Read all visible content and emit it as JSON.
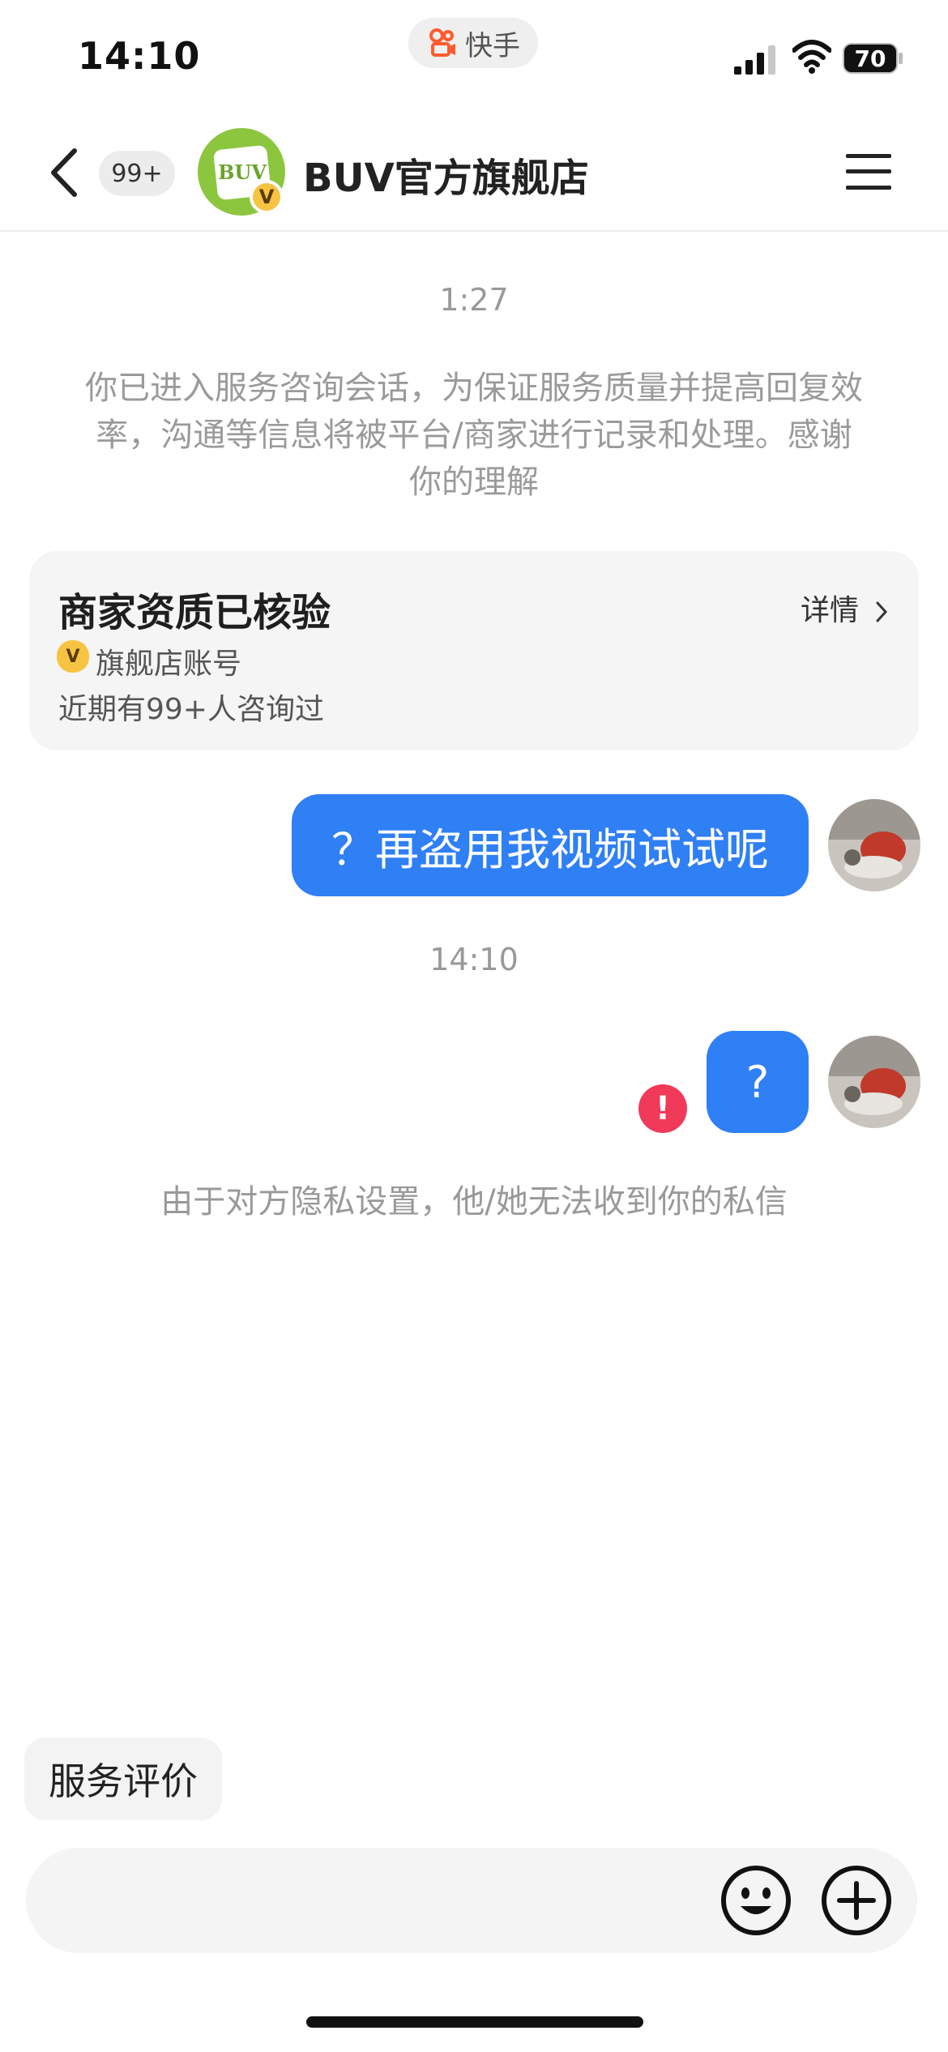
{
  "status_bar": {
    "time": "14:10",
    "app_pill": "快手",
    "battery": "70"
  },
  "header": {
    "unread_badge": "99+",
    "avatar_text": "BUV",
    "shop_name": "BUV官方旗舰店"
  },
  "chat": {
    "time1": "1:27",
    "notice": "你已进入服务咨询会话，为保证服务质量并提高回复效率，沟通等信息将被平台/商家进行记录和处理。感谢你的理解",
    "card": {
      "title": "商家资质已核验",
      "detail": "详情",
      "v_mark": "V",
      "account_type": "旗舰店账号",
      "consult_count": "近期有99+人咨询过"
    },
    "message1": "？再盗用我视频试试呢",
    "time2": "14:10",
    "message2": "?",
    "error_mark": "!",
    "privacy_note": "由于对方隐私设置，他/她无法收到你的私信"
  },
  "bottom": {
    "rate_button": "服务评价",
    "input_placeholder": ""
  },
  "colors": {
    "bubble": "#2f7ff5",
    "error": "#f13a59",
    "vip": "#f6c343",
    "avatar_green": "#8cc63f"
  }
}
